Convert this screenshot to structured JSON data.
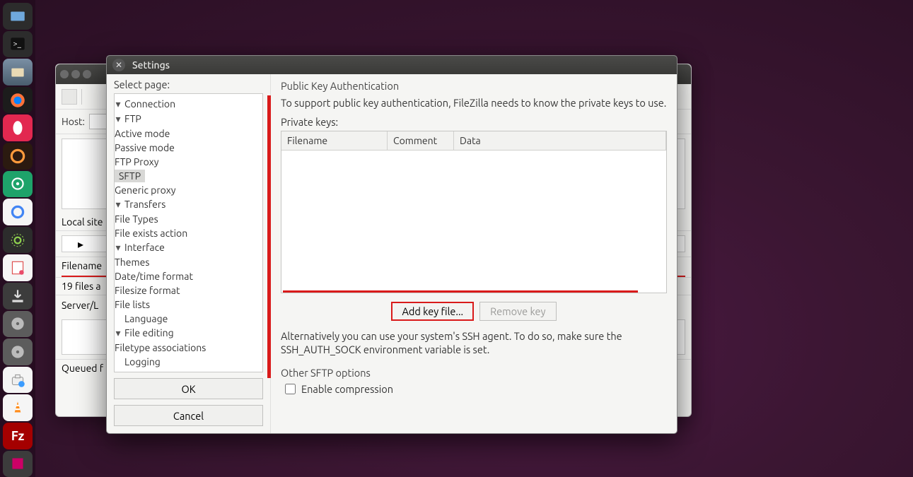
{
  "launcher": {
    "items": [
      {
        "name": "files",
        "label": "Files"
      },
      {
        "name": "terminal",
        "label": "Terminal"
      },
      {
        "name": "nautilus",
        "label": "Nautilus"
      },
      {
        "name": "firefox",
        "label": "Firefox"
      },
      {
        "name": "opera",
        "label": "Opera"
      },
      {
        "name": "software-updater",
        "label": "Software Updater"
      },
      {
        "name": "shutter",
        "label": "Shutter"
      },
      {
        "name": "google",
        "label": "Google"
      },
      {
        "name": "settings-app",
        "label": "Settings"
      },
      {
        "name": "notes",
        "label": "Notes"
      },
      {
        "name": "downloads",
        "label": "Downloads"
      },
      {
        "name": "disk1",
        "label": "Disk"
      },
      {
        "name": "disk2",
        "label": "Disk"
      },
      {
        "name": "software-center",
        "label": "Software Center"
      },
      {
        "name": "vlc",
        "label": "VLC"
      },
      {
        "name": "filezilla",
        "label": "FileZilla",
        "text": "Fz"
      },
      {
        "name": "other",
        "label": "Other"
      }
    ]
  },
  "bgwin": {
    "host_label": "Host:",
    "local_site_label": "Local site",
    "filename_label": "Filename",
    "files_status": "19 files a",
    "server_label": "Server/L",
    "queued_label": "Queued f"
  },
  "dialog": {
    "title": "Settings",
    "select_page": "Select page:",
    "tree": {
      "connection": "Connection",
      "ftp": "FTP",
      "active_mode": "Active mode",
      "passive_mode": "Passive mode",
      "ftp_proxy": "FTP Proxy",
      "sftp": "SFTP",
      "generic_proxy": "Generic proxy",
      "transfers": "Transfers",
      "file_types": "File Types",
      "file_exists": "File exists action",
      "interface": "Interface",
      "themes": "Themes",
      "datetime": "Date/time format",
      "filesize": "Filesize format",
      "filelists": "File lists",
      "language": "Language",
      "file_editing": "File editing",
      "filetype_assoc": "Filetype associations",
      "logging": "Logging"
    },
    "ok": "OK",
    "cancel": "Cancel",
    "right": {
      "group": "Public Key Authentication",
      "desc": "To support public key authentication, FileZilla needs to know the private keys to use.",
      "private_keys": "Private keys:",
      "col_filename": "Filename",
      "col_comment": "Comment",
      "col_data": "Data",
      "add_key": "Add key file...",
      "remove_key": "Remove key",
      "alt": "Alternatively you can use your system's SSH agent. To do so, make sure the SSH_AUTH_SOCK environment variable is set.",
      "other_label": "Other SFTP options",
      "enable_compression": "Enable compression"
    }
  }
}
